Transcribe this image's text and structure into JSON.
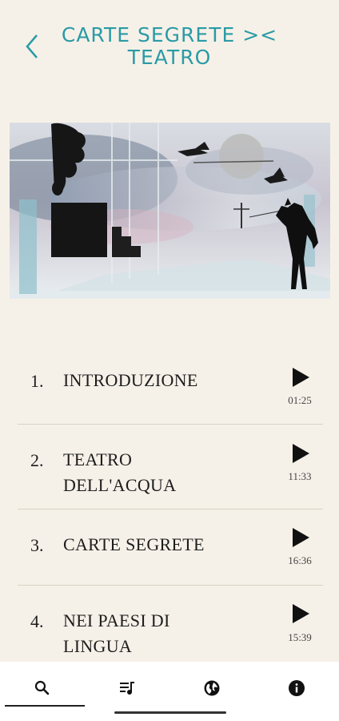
{
  "header": {
    "title_line1": "CARTE SEGRETE ><",
    "title_line2": "TEATRO",
    "back_icon": "chevron-left-icon",
    "accent_color": "#2a9ba6"
  },
  "tracks": [
    {
      "number": "1.",
      "title": "INTRODUZIONE",
      "duration": "01:25"
    },
    {
      "number": "2.",
      "title": "TEATRO DELL'ACQUA",
      "duration": "11:33"
    },
    {
      "number": "3.",
      "title": "CARTE SEGRETE",
      "duration": "16:36"
    },
    {
      "number": "4.",
      "title": "NEI PAESI DI LINGUA TEDESCA",
      "duration": "15:39"
    }
  ],
  "bottom_nav": {
    "items": [
      {
        "icon": "search-icon",
        "active": true
      },
      {
        "icon": "playlist-icon",
        "active": false
      },
      {
        "icon": "globe-icon",
        "active": false
      },
      {
        "icon": "info-icon",
        "active": false
      }
    ]
  }
}
